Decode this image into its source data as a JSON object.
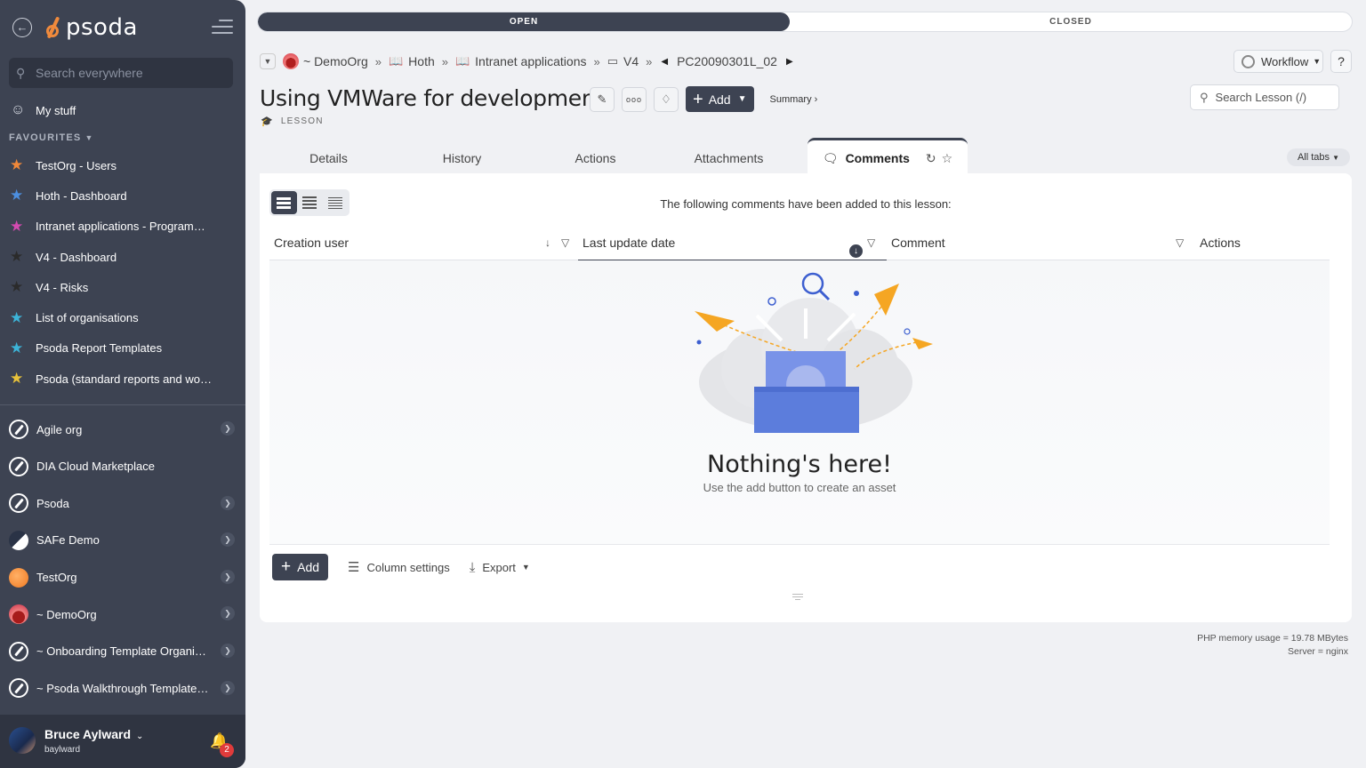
{
  "sidebar": {
    "logo_text": "psoda",
    "search_placeholder": "Search everywhere",
    "my_stuff": "My stuff",
    "favourites_label": "FAVOURITES",
    "favourites": [
      {
        "label": "TestOrg - Users",
        "star_color": "#f0883a"
      },
      {
        "label": "Hoth - Dashboard",
        "star_color": "#4c8fe0"
      },
      {
        "label": "Intranet applications - Programme...",
        "star_color": "#d44ab0"
      },
      {
        "label": "V4 - Dashboard",
        "star_color": "#2b2b2b"
      },
      {
        "label": "V4 - Risks",
        "star_color": "#2b2b2b"
      },
      {
        "label": "List of organisations",
        "star_color": "#3cb4d8"
      },
      {
        "label": "Psoda Report Templates",
        "star_color": "#3cb4d8"
      },
      {
        "label": "Psoda (standard reports and work...",
        "star_color": "#e8c23a"
      }
    ],
    "organisations": [
      {
        "label": "Agile org",
        "has_arrow": true,
        "icon": "compass"
      },
      {
        "label": "DIA Cloud Marketplace",
        "has_arrow": false,
        "icon": "compass"
      },
      {
        "label": "Psoda",
        "has_arrow": true,
        "icon": "compass"
      },
      {
        "label": "SAFe Demo",
        "has_arrow": true,
        "icon": "safe"
      },
      {
        "label": "TestOrg",
        "has_arrow": true,
        "icon": "orange"
      },
      {
        "label": "~ DemoOrg",
        "has_arrow": true,
        "icon": "demo"
      },
      {
        "label": "~ Onboarding Template Organisa...",
        "has_arrow": true,
        "icon": "compass"
      },
      {
        "label": "~ Psoda Walkthrough Template P...",
        "has_arrow": true,
        "icon": "compass"
      }
    ],
    "user": {
      "name": "Bruce Aylward",
      "login": "baylward",
      "notifications": "2"
    }
  },
  "status": {
    "open": "OPEN",
    "closed": "CLOSED"
  },
  "breadcrumb": {
    "items": [
      "~ DemoOrg",
      "Hoth",
      "Intranet applications",
      "V4"
    ],
    "current": "PC20090301L_02"
  },
  "header": {
    "title": "Using VMWare for development",
    "subtitle": "LESSON",
    "add_label": "Add",
    "summary_label": "Summary ›",
    "workflow_label": "Workflow",
    "help_label": "?",
    "search_placeholder": "Search Lesson (/)"
  },
  "tabs": {
    "items": [
      "Details",
      "History",
      "Actions",
      "Attachments"
    ],
    "active": "Comments",
    "all_tabs": "All tabs"
  },
  "comments": {
    "intro": "The following comments have been added to this lesson:",
    "columns": [
      "Creation user",
      "Last update date",
      "Comment",
      "Actions"
    ],
    "empty_title": "Nothing's here!",
    "empty_subtitle": "Use the add button to create an asset",
    "add_label": "Add",
    "column_settings": "Column settings",
    "export": "Export"
  },
  "footer": {
    "memory": "PHP memory usage = 19.78 MBytes",
    "server": "Server = nginx"
  }
}
